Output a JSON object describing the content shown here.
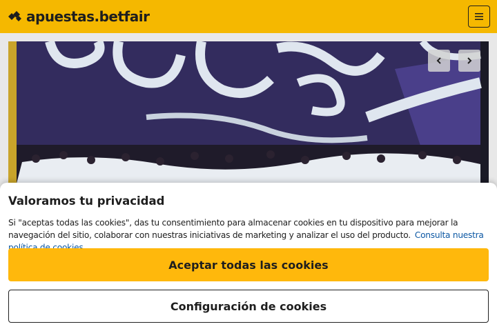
{
  "header": {
    "logo_text": "apuestas.betfair",
    "logo_icon": "betfair-diamond-logo-icon",
    "menu_icon": "hamburger-menu-icon",
    "background_color": "#f5b800"
  },
  "carousel": {
    "prev_icon": "chevron-left-icon",
    "next_icon": "chevron-right-icon"
  },
  "cookie_banner": {
    "title": "Valoramos tu privacidad",
    "body": "Si \"aceptas todas las cookies\", das tu consentimiento para almacenar cookies en tu dispositivo para mejorar la navegación del sitio, colaborar con nuestras iniciativas de marketing y analizar el uso del producto.",
    "policy_link": "Consulta nuestra política de cookies",
    "accept_label": "Aceptar todas las cookies",
    "config_label": "Configuración de cookies",
    "accept_color": "#ffb80c",
    "link_color": "#0b57a3"
  }
}
